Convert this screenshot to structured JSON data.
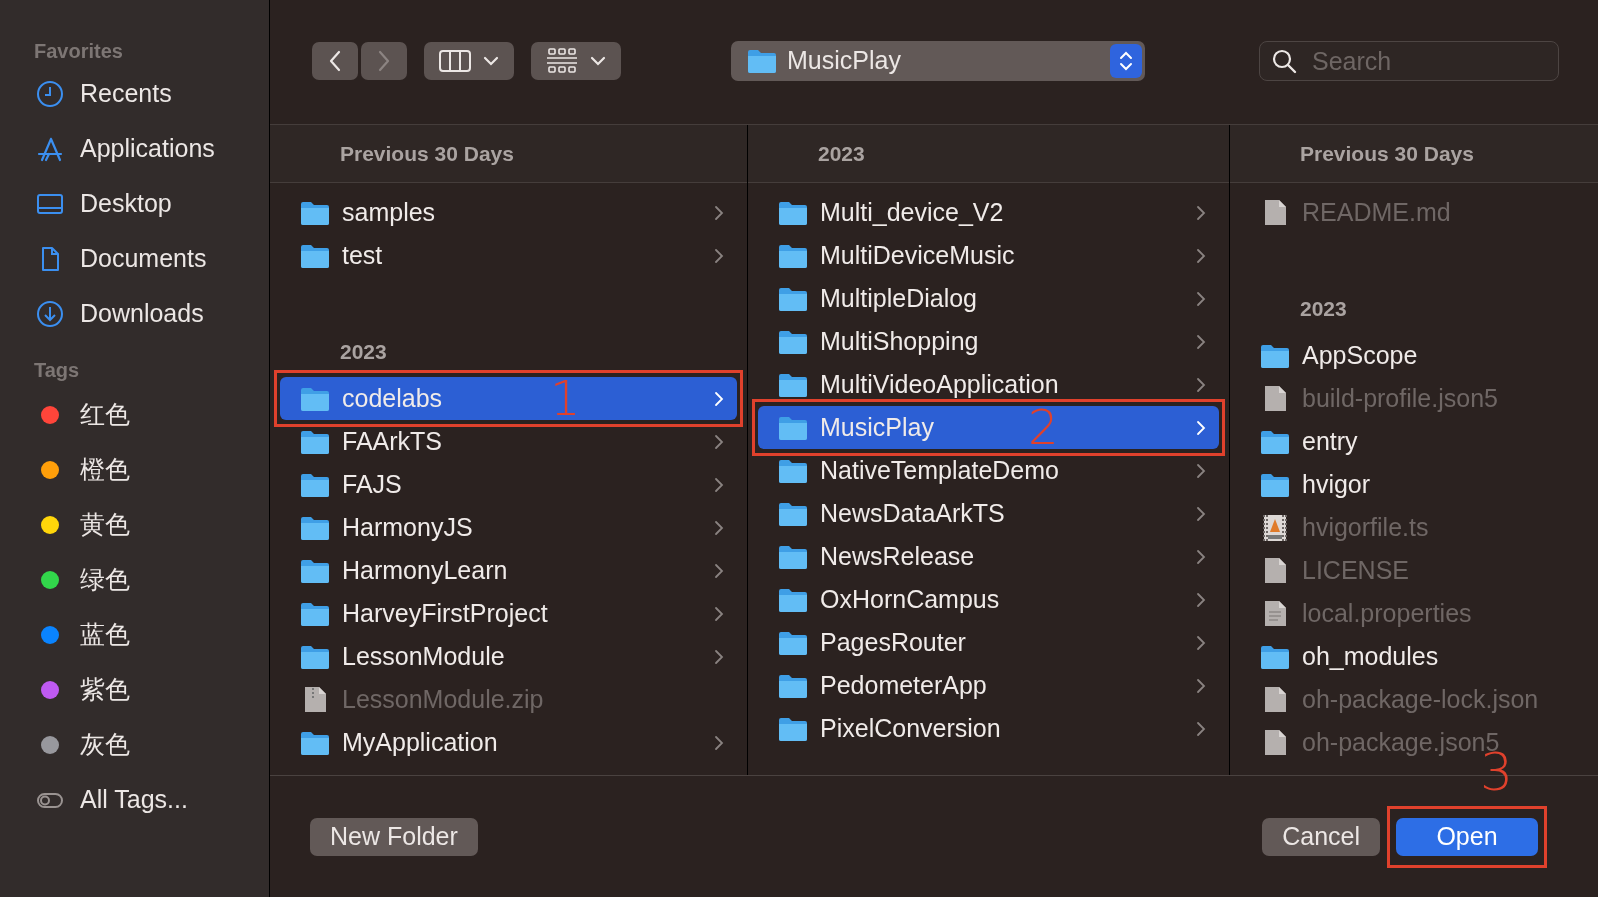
{
  "sidebar": {
    "sections": [
      {
        "title": "Favorites",
        "items": [
          {
            "label": "Recents",
            "kind": "clock"
          },
          {
            "label": "Applications",
            "kind": "apps"
          },
          {
            "label": "Desktop",
            "kind": "desktop"
          },
          {
            "label": "Documents",
            "kind": "document"
          },
          {
            "label": "Downloads",
            "kind": "download"
          }
        ]
      },
      {
        "title": "Tags",
        "items": [
          {
            "label": "红色",
            "kind": "tag",
            "color": "#ff453a"
          },
          {
            "label": "橙色",
            "kind": "tag",
            "color": "#ff9f0a"
          },
          {
            "label": "黄色",
            "kind": "tag",
            "color": "#ffd60a"
          },
          {
            "label": "绿色",
            "kind": "tag",
            "color": "#32d74b"
          },
          {
            "label": "蓝色",
            "kind": "tag",
            "color": "#0a84ff"
          },
          {
            "label": "紫色",
            "kind": "tag",
            "color": "#bf5af2"
          },
          {
            "label": "灰色",
            "kind": "tag",
            "color": "#98989d"
          },
          {
            "label": "All Tags...",
            "kind": "all_tags"
          }
        ]
      }
    ]
  },
  "toolbar": {
    "back_button": {
      "disabled": false
    },
    "forward_button": {
      "disabled": true
    },
    "path_popup": {
      "label": "MusicPlay"
    },
    "search": {
      "placeholder": "Search"
    }
  },
  "columns": [
    {
      "groups": [
        {
          "title": "Previous 30 Days",
          "items": [
            {
              "name": "samples",
              "kind": "folder",
              "expandable": true,
              "selected": false,
              "disabled": false
            },
            {
              "name": "test",
              "kind": "folder",
              "expandable": true,
              "selected": false,
              "disabled": false
            }
          ]
        },
        {
          "title": "2023",
          "items": [
            {
              "name": "codelabs",
              "kind": "folder",
              "expandable": true,
              "selected": true,
              "disabled": false,
              "annotation": "1"
            },
            {
              "name": "FAArkTS",
              "kind": "folder",
              "expandable": true,
              "selected": false,
              "disabled": false
            },
            {
              "name": "FAJS",
              "kind": "folder",
              "expandable": true,
              "selected": false,
              "disabled": false
            },
            {
              "name": "HarmonyJS",
              "kind": "folder",
              "expandable": true,
              "selected": false,
              "disabled": false
            },
            {
              "name": "HarmonyLearn",
              "kind": "folder",
              "expandable": true,
              "selected": false,
              "disabled": false
            },
            {
              "name": "HarveyFirstProject",
              "kind": "folder",
              "expandable": true,
              "selected": false,
              "disabled": false
            },
            {
              "name": "LessonModule",
              "kind": "folder",
              "expandable": true,
              "selected": false,
              "disabled": false
            },
            {
              "name": "LessonModule.zip",
              "kind": "zip",
              "expandable": false,
              "selected": false,
              "disabled": true
            },
            {
              "name": "MyApplication",
              "kind": "folder",
              "expandable": true,
              "selected": false,
              "disabled": false
            }
          ]
        }
      ]
    },
    {
      "groups": [
        {
          "title": "2023",
          "items": [
            {
              "name": "Multi_device_V2",
              "kind": "folder",
              "expandable": true,
              "selected": false,
              "disabled": false
            },
            {
              "name": "MultiDeviceMusic",
              "kind": "folder",
              "expandable": true,
              "selected": false,
              "disabled": false
            },
            {
              "name": "MultipleDialog",
              "kind": "folder",
              "expandable": true,
              "selected": false,
              "disabled": false
            },
            {
              "name": "MultiShopping",
              "kind": "folder",
              "expandable": true,
              "selected": false,
              "disabled": false
            },
            {
              "name": "MultiVideoApplication",
              "kind": "folder",
              "expandable": true,
              "selected": false,
              "disabled": false
            },
            {
              "name": "MusicPlay",
              "kind": "folder",
              "expandable": true,
              "selected": true,
              "disabled": false,
              "annotation": "2"
            },
            {
              "name": "NativeTemplateDemo",
              "kind": "folder",
              "expandable": true,
              "selected": false,
              "disabled": false
            },
            {
              "name": "NewsDataArkTS",
              "kind": "folder",
              "expandable": true,
              "selected": false,
              "disabled": false
            },
            {
              "name": "NewsRelease",
              "kind": "folder",
              "expandable": true,
              "selected": false,
              "disabled": false
            },
            {
              "name": "OxHornCampus",
              "kind": "folder",
              "expandable": true,
              "selected": false,
              "disabled": false
            },
            {
              "name": "PagesRouter",
              "kind": "folder",
              "expandable": true,
              "selected": false,
              "disabled": false
            },
            {
              "name": "PedometerApp",
              "kind": "folder",
              "expandable": true,
              "selected": false,
              "disabled": false
            },
            {
              "name": "PixelConversion",
              "kind": "folder",
              "expandable": true,
              "selected": false,
              "disabled": false
            }
          ]
        }
      ]
    },
    {
      "groups": [
        {
          "title": "Previous 30 Days",
          "items": [
            {
              "name": "README.md",
              "kind": "file",
              "expandable": false,
              "selected": false,
              "disabled": true
            }
          ]
        },
        {
          "title": "2023",
          "items": [
            {
              "name": "AppScope",
              "kind": "folder",
              "expandable": false,
              "selected": false,
              "disabled": false
            },
            {
              "name": "build-profile.json5",
              "kind": "file",
              "expandable": false,
              "selected": false,
              "disabled": true
            },
            {
              "name": "entry",
              "kind": "folder",
              "expandable": false,
              "selected": false,
              "disabled": false
            },
            {
              "name": "hvigor",
              "kind": "folder",
              "expandable": false,
              "selected": false,
              "disabled": false
            },
            {
              "name": "hvigorfile.ts",
              "kind": "video",
              "expandable": false,
              "selected": false,
              "disabled": true
            },
            {
              "name": "LICENSE",
              "kind": "file",
              "expandable": false,
              "selected": false,
              "disabled": true
            },
            {
              "name": "local.properties",
              "kind": "text",
              "expandable": false,
              "selected": false,
              "disabled": true
            },
            {
              "name": "oh_modules",
              "kind": "folder",
              "expandable": false,
              "selected": false,
              "disabled": false
            },
            {
              "name": "oh-package-lock.json",
              "kind": "file",
              "expandable": false,
              "selected": false,
              "disabled": true
            },
            {
              "name": "oh-package.json5",
              "kind": "file",
              "expandable": false,
              "selected": false,
              "disabled": true
            }
          ]
        }
      ]
    }
  ],
  "footer": {
    "buttons": [
      {
        "label": "New Folder",
        "kind": "secondary"
      },
      {
        "label": "Cancel",
        "kind": "secondary"
      },
      {
        "label": "Open",
        "kind": "primary",
        "annotation": "3"
      }
    ]
  }
}
